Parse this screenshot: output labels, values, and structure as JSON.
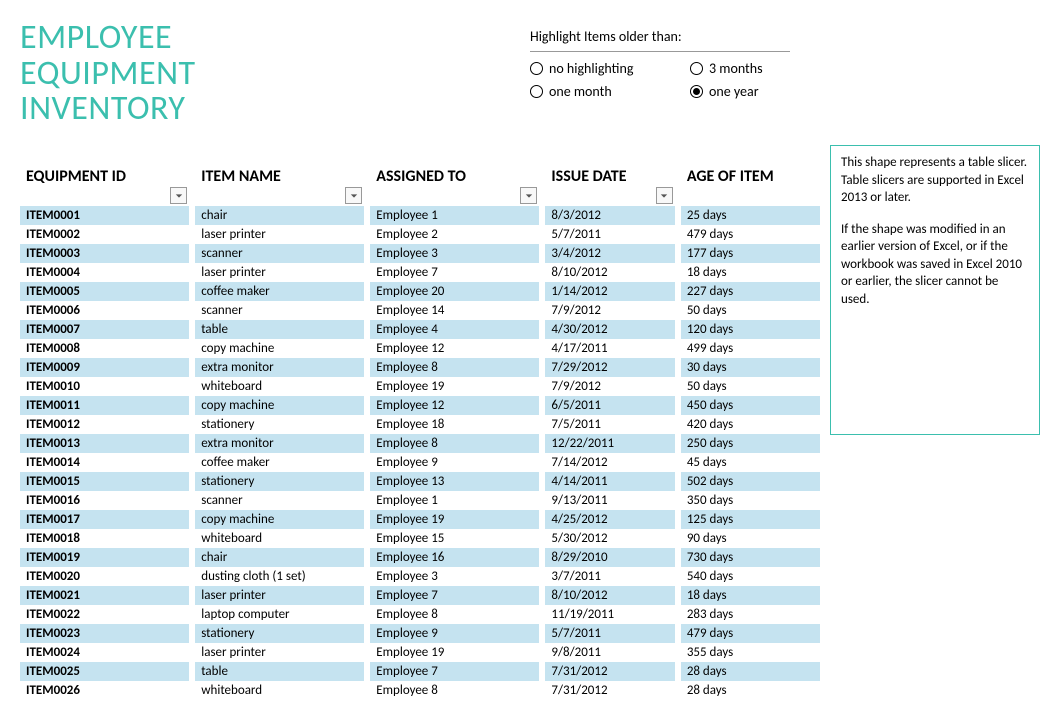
{
  "title_line1": "EMPLOYEE",
  "title_line2": "EQUIPMENT",
  "title_line3": "INVENTORY",
  "highlight": {
    "label": "Highlight Items older than:",
    "options": [
      "no highlighting",
      "one month",
      "3 months",
      "one year"
    ],
    "selected": "one year"
  },
  "columns": {
    "id": "EQUIPMENT ID",
    "item": "ITEM NAME",
    "assigned": "ASSIGNED TO",
    "date": "ISSUE DATE",
    "age": "AGE OF ITEM"
  },
  "rows": [
    {
      "id": "ITEM0001",
      "item": "chair",
      "assigned": "Employee 1",
      "date": "8/3/2012",
      "age": "25 days"
    },
    {
      "id": "ITEM0002",
      "item": "laser printer",
      "assigned": "Employee 2",
      "date": "5/7/2011",
      "age": "479 days"
    },
    {
      "id": "ITEM0003",
      "item": "scanner",
      "assigned": "Employee 3",
      "date": "3/4/2012",
      "age": "177 days"
    },
    {
      "id": "ITEM0004",
      "item": "laser printer",
      "assigned": "Employee 7",
      "date": "8/10/2012",
      "age": "18 days"
    },
    {
      "id": "ITEM0005",
      "item": "coffee maker",
      "assigned": "Employee 20",
      "date": "1/14/2012",
      "age": "227 days"
    },
    {
      "id": "ITEM0006",
      "item": "scanner",
      "assigned": "Employee 14",
      "date": "7/9/2012",
      "age": "50 days"
    },
    {
      "id": "ITEM0007",
      "item": "table",
      "assigned": "Employee 4",
      "date": "4/30/2012",
      "age": "120 days"
    },
    {
      "id": "ITEM0008",
      "item": "copy machine",
      "assigned": "Employee 12",
      "date": "4/17/2011",
      "age": "499 days"
    },
    {
      "id": "ITEM0009",
      "item": "extra monitor",
      "assigned": "Employee 8",
      "date": "7/29/2012",
      "age": "30 days"
    },
    {
      "id": "ITEM0010",
      "item": "whiteboard",
      "assigned": "Employee 19",
      "date": "7/9/2012",
      "age": "50 days"
    },
    {
      "id": "ITEM0011",
      "item": "copy machine",
      "assigned": "Employee 12",
      "date": "6/5/2011",
      "age": "450 days"
    },
    {
      "id": "ITEM0012",
      "item": "stationery",
      "assigned": "Employee 18",
      "date": "7/5/2011",
      "age": "420 days"
    },
    {
      "id": "ITEM0013",
      "item": "extra monitor",
      "assigned": "Employee 8",
      "date": "12/22/2011",
      "age": "250 days"
    },
    {
      "id": "ITEM0014",
      "item": "coffee maker",
      "assigned": "Employee 9",
      "date": "7/14/2012",
      "age": "45 days"
    },
    {
      "id": "ITEM0015",
      "item": "stationery",
      "assigned": "Employee 13",
      "date": "4/14/2011",
      "age": "502 days"
    },
    {
      "id": "ITEM0016",
      "item": "scanner",
      "assigned": "Employee 1",
      "date": "9/13/2011",
      "age": "350 days"
    },
    {
      "id": "ITEM0017",
      "item": "copy machine",
      "assigned": "Employee 19",
      "date": "4/25/2012",
      "age": "125 days"
    },
    {
      "id": "ITEM0018",
      "item": "whiteboard",
      "assigned": "Employee 15",
      "date": "5/30/2012",
      "age": "90 days"
    },
    {
      "id": "ITEM0019",
      "item": "chair",
      "assigned": "Employee 16",
      "date": "8/29/2010",
      "age": "730 days"
    },
    {
      "id": "ITEM0020",
      "item": "dusting cloth (1 set)",
      "assigned": "Employee 3",
      "date": "3/7/2011",
      "age": "540 days"
    },
    {
      "id": "ITEM0021",
      "item": "laser printer",
      "assigned": "Employee 7",
      "date": "8/10/2012",
      "age": "18 days"
    },
    {
      "id": "ITEM0022",
      "item": "laptop computer",
      "assigned": "Employee 8",
      "date": "11/19/2011",
      "age": "283 days"
    },
    {
      "id": "ITEM0023",
      "item": "stationery",
      "assigned": "Employee 9",
      "date": "5/7/2011",
      "age": "479 days"
    },
    {
      "id": "ITEM0024",
      "item": "laser printer",
      "assigned": "Employee 19",
      "date": "9/8/2011",
      "age": "355 days"
    },
    {
      "id": "ITEM0025",
      "item": "table",
      "assigned": "Employee 7",
      "date": "7/31/2012",
      "age": "28 days"
    },
    {
      "id": "ITEM0026",
      "item": "whiteboard",
      "assigned": "Employee 8",
      "date": "7/31/2012",
      "age": "28 days"
    }
  ],
  "slicer": {
    "p1": "This shape represents a table slicer. Table slicers are supported in Excel 2013 or later.",
    "p2": "If the shape was modified in an earlier version of Excel, or if the workbook was saved in Excel 2010 or earlier, the slicer cannot be used."
  }
}
